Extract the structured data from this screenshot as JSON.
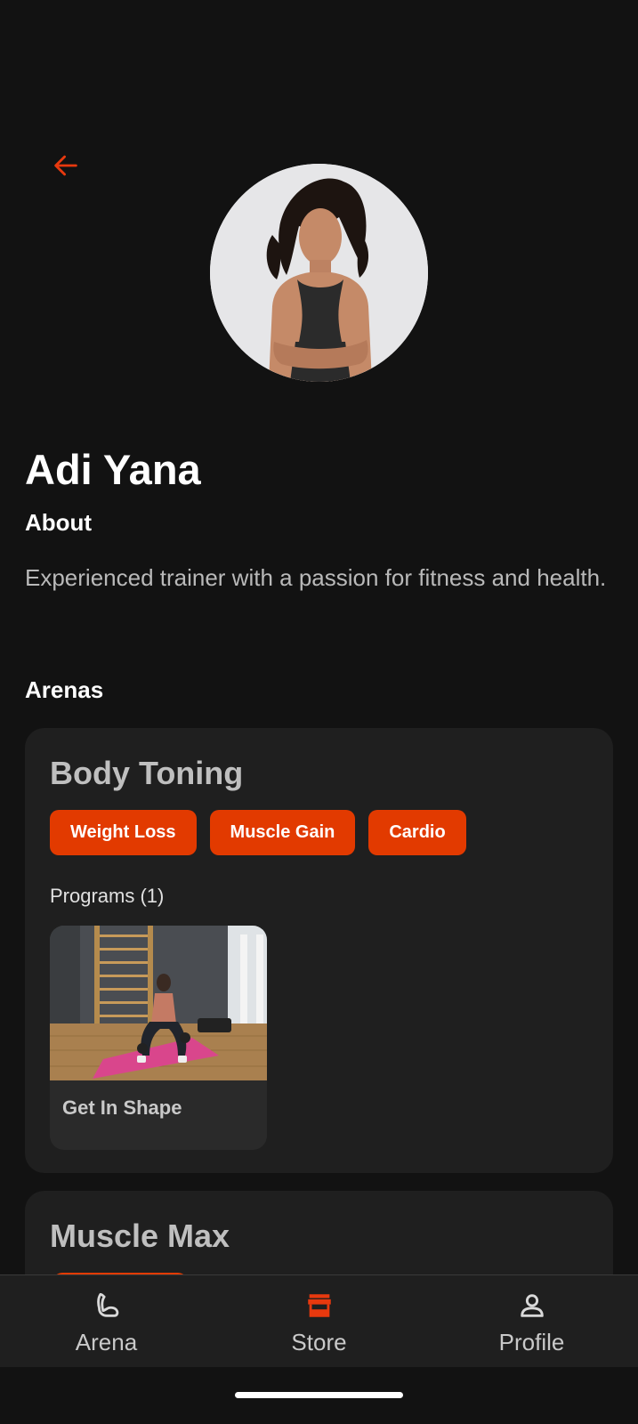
{
  "trainer": {
    "name": "Adi Yana"
  },
  "about": {
    "heading": "About",
    "text": "Experienced trainer with a passion for fitness and health."
  },
  "arenas": {
    "heading": "Arenas",
    "items": [
      {
        "title": "Body Toning",
        "tags": [
          "Weight Loss",
          "Muscle Gain",
          "Cardio"
        ],
        "programs_label": "Programs (1)",
        "programs": [
          {
            "title": "Get In Shape"
          }
        ]
      },
      {
        "title": "Muscle Max"
      }
    ]
  },
  "nav": {
    "items": [
      {
        "label": "Arena",
        "icon": "arm-flex-icon",
        "active": false
      },
      {
        "label": "Store",
        "icon": "store-icon",
        "active": true
      },
      {
        "label": "Profile",
        "icon": "person-icon",
        "active": false
      }
    ]
  },
  "colors": {
    "background": "#121212",
    "card": "#1f1f1f",
    "accent": "#e23a00",
    "muted_text": "#b9b9b9"
  }
}
